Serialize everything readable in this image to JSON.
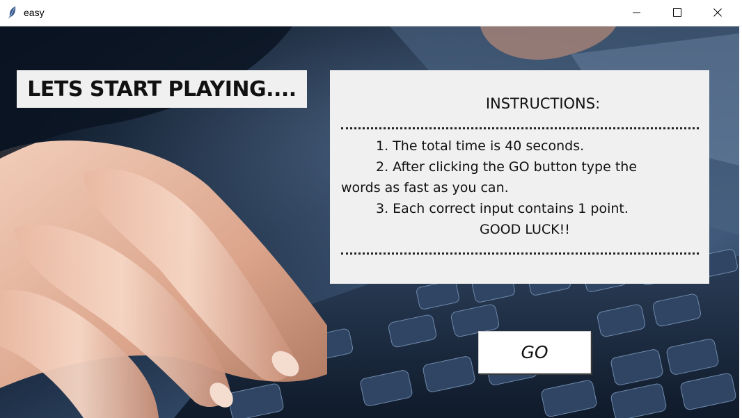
{
  "window": {
    "title": "easy",
    "controls": {
      "minimize_icon": "minimize-icon",
      "maximize_icon": "maximize-icon",
      "close_icon": "close-icon"
    }
  },
  "heading": {
    "text": "LETS START PLAYING...."
  },
  "instructions": {
    "title": "INSTRUCTIONS:",
    "line1": "1. The total  time is 40 seconds.",
    "line2": "2. After clicking the GO button type the",
    "line3": "words as fast as you can.",
    "line4": "3. Each correct input contains 1 point.",
    "line5": "GOOD LUCK!!"
  },
  "go_button": {
    "label": "GO"
  },
  "colors": {
    "widget_background": "#f0f0f0",
    "button_background": "#ffffff",
    "text": "#111111",
    "backdrop": "#0b1624"
  },
  "background_image": "hand-typing-on-keyboard-photo"
}
